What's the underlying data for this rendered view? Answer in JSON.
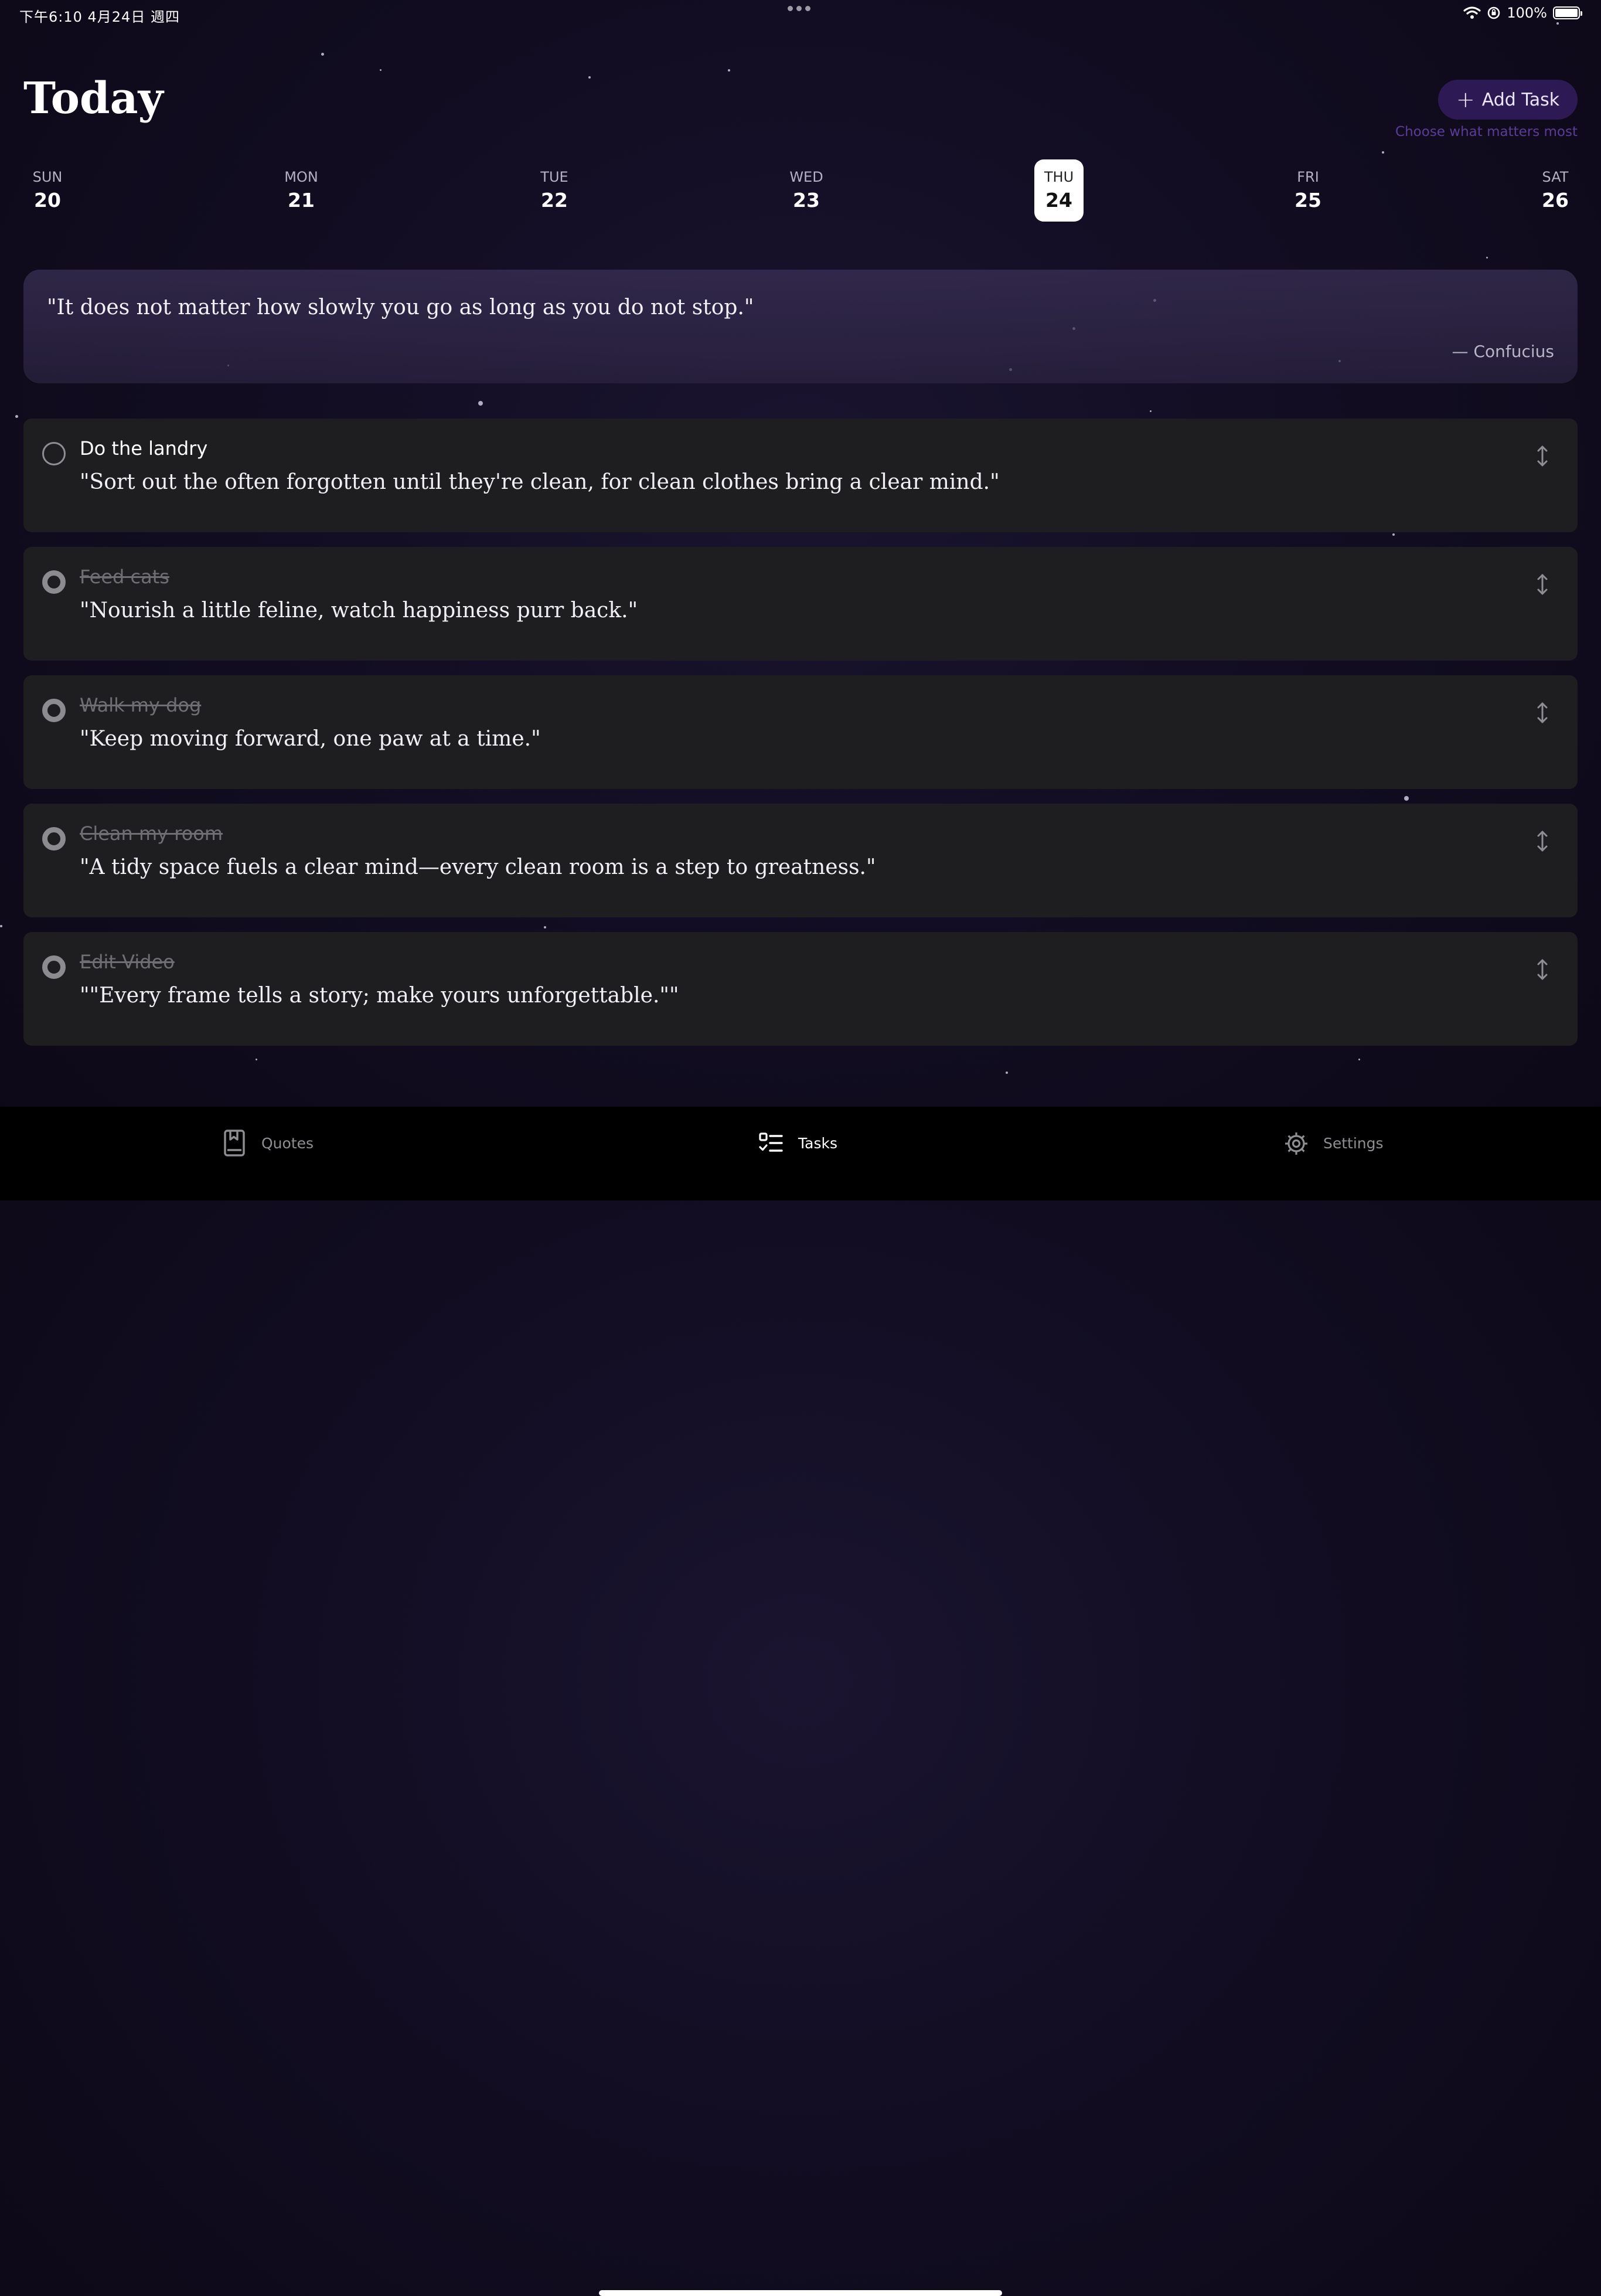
{
  "status_bar": {
    "time_date": "下午6:10  4月24日 週四",
    "battery": "100%",
    "battery_level": 1.0
  },
  "header": {
    "title": "Today",
    "add_task_label": "Add Task",
    "add_task_icon": "plus-icon",
    "tagline": "Choose what matters most"
  },
  "week": {
    "selected_index": 4,
    "days": [
      {
        "name": "SUN",
        "num": "20"
      },
      {
        "name": "MON",
        "num": "21"
      },
      {
        "name": "TUE",
        "num": "22"
      },
      {
        "name": "WED",
        "num": "23"
      },
      {
        "name": "THU",
        "num": "24"
      },
      {
        "name": "FRI",
        "num": "25"
      },
      {
        "name": "SAT",
        "num": "26"
      }
    ]
  },
  "daily_quote": {
    "text": "\"It does not matter how slowly you go as long as you do not stop.\"",
    "author": "— Confucius"
  },
  "tasks": [
    {
      "title": "Do the landry",
      "quote": "\"Sort out the often forgotten until they're clean, for clean clothes bring a clear mind.\"",
      "done": false
    },
    {
      "title": "Feed cats",
      "quote": "\"Nourish a little feline, watch happiness purr back.\"",
      "done": true
    },
    {
      "title": "Walk my dog",
      "quote": "\"Keep moving forward, one paw at a time.\"",
      "done": true
    },
    {
      "title": "Clean my room",
      "quote": "\"A tidy space fuels a clear mind—every clean room is a step to greatness.\"",
      "done": true
    },
    {
      "title": "Edit Video",
      "quote": "\"\"Every frame tells a story; make yours unforgettable.\"\"",
      "done": true
    }
  ],
  "tab_bar": {
    "tabs": [
      {
        "label": "Quotes",
        "icon": "bookmark-book-icon",
        "active": false
      },
      {
        "label": "Tasks",
        "icon": "checklist-icon",
        "active": true
      },
      {
        "label": "Settings",
        "icon": "gear-icon",
        "active": false
      }
    ]
  },
  "colors": {
    "background": "#120d22",
    "accent": "#2d1a55",
    "tagline": "#5b3d96",
    "card": "#1e1e20"
  }
}
